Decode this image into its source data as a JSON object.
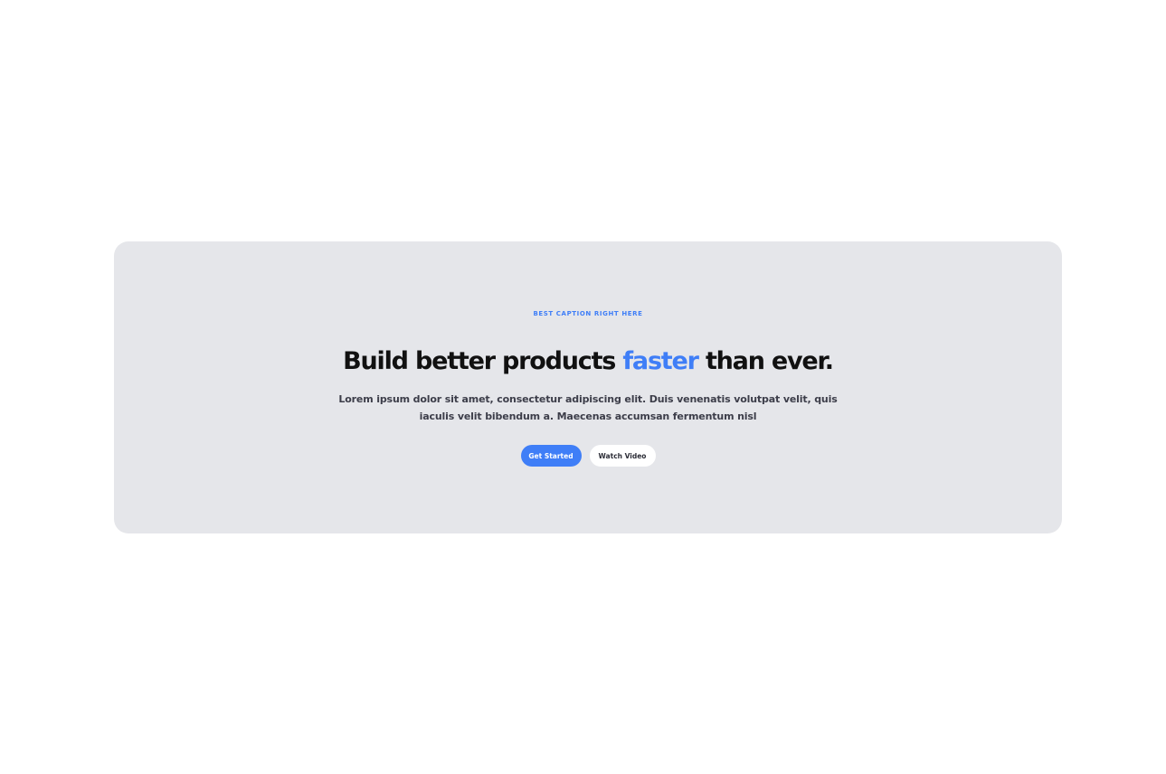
{
  "hero": {
    "caption": "BEST CAPTION RIGHT HERE",
    "headline_before": "Build better products ",
    "headline_accent": "faster",
    "headline_after": " than ever.",
    "subtext": "Lorem ipsum dolor sit amet, consectetur adipiscing elit. Duis venenatis volutpat velit, quis iaculis velit bibendum a. Maecenas accumsan fermentum nisl",
    "primary_button": "Get Started",
    "secondary_button": "Watch Video"
  },
  "colors": {
    "accent": "#3f7ef7",
    "card_background": "#e5e6ea",
    "page_background": "#ffffff",
    "headline": "#111111"
  }
}
